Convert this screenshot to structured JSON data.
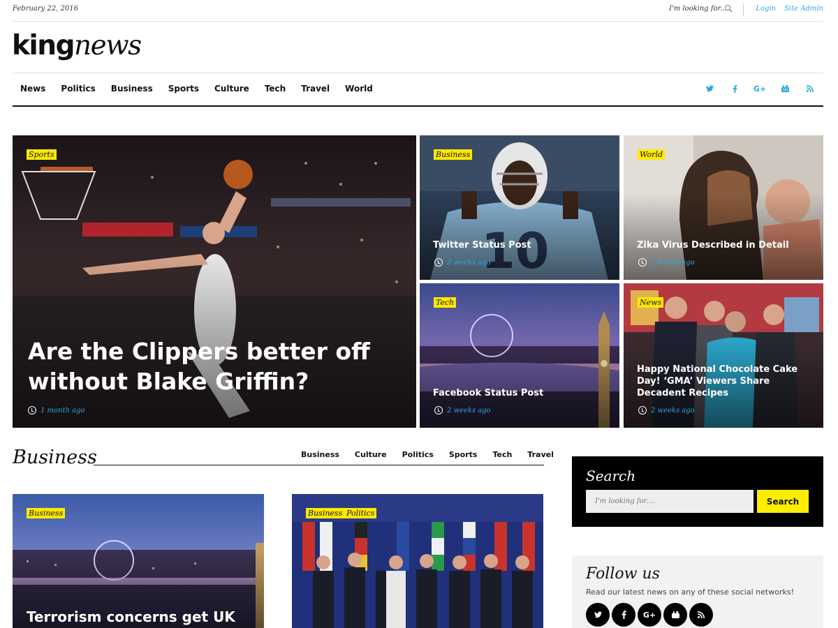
{
  "topbar": {
    "date": "February 22, 2016",
    "search_placeholder": "I'm looking for....",
    "login": "Login",
    "site_admin": "Site Admin"
  },
  "logo": {
    "part1": "king",
    "part2": "news"
  },
  "nav": {
    "items": [
      "News",
      "Politics",
      "Business",
      "Sports",
      "Culture",
      "Tech",
      "Travel",
      "World"
    ],
    "social_icons": [
      "twitter-icon",
      "facebook-icon",
      "google-plus-icon",
      "youtube-icon",
      "rss-icon"
    ]
  },
  "featured": [
    {
      "tag": "Sports",
      "title": "Are the Clippers better off without Blake Griffin?",
      "time": "1 month ago"
    },
    {
      "tag": "Business",
      "title": "Twitter Status Post",
      "time": "2 weeks ago"
    },
    {
      "tag": "World",
      "title": "Zika Virus Described in Detail",
      "time": "2 weeks ago"
    },
    {
      "tag": "Tech",
      "title": "Facebook Status Post",
      "time": "2 weeks ago"
    },
    {
      "tag": "News",
      "title": "Happy National Chocolate Cake Day! ‘GMA’ Viewers Share Decadent Recipes",
      "time": "2 weeks ago"
    }
  ],
  "business": {
    "title": "Business",
    "tabs": [
      "Business",
      "Culture",
      "Politics",
      "Sports",
      "Tech",
      "Travel"
    ],
    "posts": [
      {
        "tags": [
          "Business"
        ],
        "title": "Terrorism concerns get UK"
      },
      {
        "tags": [
          "Business",
          "Politics"
        ],
        "title": ""
      }
    ]
  },
  "sidebar": {
    "search": {
      "title": "Search",
      "placeholder": "I'm looking for....",
      "button": "Search"
    },
    "follow": {
      "title": "Follow us",
      "description": "Read our latest news on any of these social networks!",
      "icons": [
        "twitter-icon",
        "facebook-icon",
        "google-plus-icon",
        "youtube-icon",
        "rss-icon"
      ]
    }
  },
  "colors": {
    "accent": "#2aa7e0",
    "tag": "#ffe900",
    "button": "#ffee00",
    "dark": "#000000"
  }
}
